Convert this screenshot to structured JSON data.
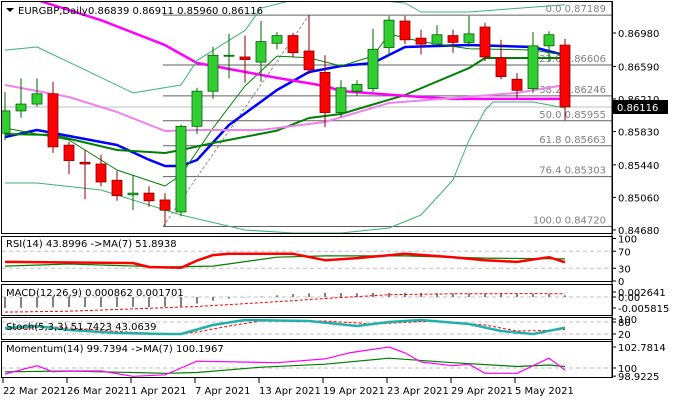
{
  "header": {
    "symbol": "EURGBP,Daily",
    "ohlc": "0.86839 0.86911 0.85960 0.86116"
  },
  "colors": {
    "bull": "#32cd32",
    "bear": "#ff0000",
    "bull_border": "#006400",
    "bear_border": "#8b0000",
    "ema_blue": "#0000ff",
    "ma_green": "#008000",
    "ma_magenta": "#ff00ff",
    "ma_violet": "#ee82ee",
    "bollinger": "#3cb371",
    "macd_hist": "#808080",
    "stoch_k": "#20b2aa"
  },
  "chart_data": {
    "type": "candlestick",
    "title": "EURGBP,Daily",
    "ylim": [
      0.8462,
      0.8738
    ],
    "price_axis_ticks": [
      "0.86980",
      "0.86590",
      "0.86210",
      "0.85830",
      "0.85440",
      "0.85060",
      "0.84680"
    ],
    "price_axis_values": [
      0.8698,
      0.8659,
      0.8621,
      0.8583,
      0.8544,
      0.8506,
      0.8468
    ],
    "current_price": "0.86116",
    "date_ticks": [
      {
        "i": 0,
        "label": "22 Mar 2021"
      },
      {
        "i": 4,
        "label": "26 Mar 2021"
      },
      {
        "i": 8,
        "label": "1 Apr 2021"
      },
      {
        "i": 12,
        "label": "7 Apr 2021"
      },
      {
        "i": 16,
        "label": "13 Apr 2021"
      },
      {
        "i": 20,
        "label": "19 Apr 2021"
      },
      {
        "i": 24,
        "label": "23 Apr 2021"
      },
      {
        "i": 28,
        "label": "29 Apr 2021"
      },
      {
        "i": 32,
        "label": "5 May 2021"
      }
    ],
    "candles": [
      [
        0.8581,
        0.8629,
        0.8573,
        0.8607
      ],
      [
        0.8607,
        0.8645,
        0.8599,
        0.8615
      ],
      [
        0.8615,
        0.8645,
        0.8612,
        0.8627
      ],
      [
        0.8627,
        0.8641,
        0.8558,
        0.8565
      ],
      [
        0.8567,
        0.8571,
        0.8533,
        0.8549
      ],
      [
        0.8547,
        0.8561,
        0.8504,
        0.8545
      ],
      [
        0.8545,
        0.8556,
        0.8519,
        0.8524
      ],
      [
        0.8526,
        0.8537,
        0.8502,
        0.8508
      ],
      [
        0.8509,
        0.8532,
        0.8491,
        0.8511
      ],
      [
        0.8511,
        0.8519,
        0.8495,
        0.8502
      ],
      [
        0.8503,
        0.8511,
        0.8472,
        0.8491
      ],
      [
        0.8489,
        0.8591,
        0.8484,
        0.8589
      ],
      [
        0.8589,
        0.8634,
        0.858,
        0.863
      ],
      [
        0.863,
        0.8682,
        0.8621,
        0.8672
      ],
      [
        0.8671,
        0.8697,
        0.8645,
        0.8672
      ],
      [
        0.867,
        0.8695,
        0.864,
        0.8667
      ],
      [
        0.8664,
        0.8712,
        0.8641,
        0.8688
      ],
      [
        0.8686,
        0.8699,
        0.8679,
        0.8695
      ],
      [
        0.8695,
        0.8698,
        0.867,
        0.8675
      ],
      [
        0.8677,
        0.87189,
        0.865,
        0.8655
      ],
      [
        0.8652,
        0.8672,
        0.8588,
        0.8605
      ],
      [
        0.8605,
        0.8643,
        0.86,
        0.8634
      ],
      [
        0.863,
        0.8643,
        0.8625,
        0.8638
      ],
      [
        0.8633,
        0.8703,
        0.8629,
        0.8679
      ],
      [
        0.8681,
        0.8718,
        0.8671,
        0.8713
      ],
      [
        0.8712,
        0.8718,
        0.8685,
        0.869
      ],
      [
        0.8692,
        0.8702,
        0.8673,
        0.8685
      ],
      [
        0.8685,
        0.8707,
        0.8684,
        0.8696
      ],
      [
        0.8695,
        0.8702,
        0.8675,
        0.8687
      ],
      [
        0.8687,
        0.8718,
        0.8682,
        0.8697
      ],
      [
        0.8705,
        0.871,
        0.8665,
        0.867
      ],
      [
        0.8669,
        0.869,
        0.8644,
        0.8647
      ],
      [
        0.8644,
        0.8651,
        0.8622,
        0.8631
      ],
      [
        0.8633,
        0.8699,
        0.8628,
        0.8683
      ],
      [
        0.8683,
        0.87,
        0.8665,
        0.8696
      ],
      [
        0.86839,
        0.86911,
        0.8596,
        0.86116
      ]
    ],
    "overlays": [
      {
        "name": "ema-blue",
        "color": "#0000ff",
        "width": 2.5,
        "points": [
          [
            0,
            0.85765
          ],
          [
            2,
            0.85847
          ],
          [
            7,
            0.85672
          ],
          [
            9,
            0.855
          ],
          [
            10,
            0.85427
          ],
          [
            11,
            0.85427
          ],
          [
            12,
            0.85497
          ],
          [
            14,
            0.85905
          ],
          [
            17,
            0.86314
          ],
          [
            19,
            0.86524
          ],
          [
            21,
            0.86595
          ],
          [
            23,
            0.8663
          ],
          [
            25,
            0.86816
          ],
          [
            29,
            0.8684
          ],
          [
            33,
            0.86816
          ],
          [
            35,
            0.8672
          ]
        ]
      },
      {
        "name": "ma-green-slow",
        "color": "#008000",
        "width": 2,
        "points": [
          [
            0,
            0.858
          ],
          [
            3,
            0.85789
          ],
          [
            7,
            0.85613
          ],
          [
            10,
            0.85578
          ],
          [
            11,
            0.85613
          ],
          [
            13,
            0.85695
          ],
          [
            17,
            0.8584
          ],
          [
            19,
            0.85987
          ],
          [
            21,
            0.86034
          ],
          [
            25,
            0.86256
          ],
          [
            29,
            0.8657
          ],
          [
            30,
            0.86688
          ],
          [
            35,
            0.86688
          ]
        ]
      },
      {
        "name": "ma-green-fast",
        "color": "#008000",
        "width": 1,
        "points": [
          [
            0,
            0.8587
          ],
          [
            4,
            0.8573
          ],
          [
            7,
            0.8538
          ],
          [
            10,
            0.85193
          ],
          [
            11,
            0.85321
          ],
          [
            13,
            0.8587
          ],
          [
            15,
            0.86361
          ],
          [
            17,
            0.8671
          ],
          [
            19,
            0.8669
          ],
          [
            21,
            0.86595
          ],
          [
            23,
            0.8671
          ],
          [
            24,
            0.86968
          ],
          [
            26,
            0.8688
          ],
          [
            29,
            0.86795
          ],
          [
            33,
            0.86781
          ],
          [
            35,
            0.8672
          ]
        ]
      },
      {
        "name": "ma-magenta",
        "color": "#ff00ff",
        "width": 2.5,
        "points": [
          [
            2,
            0.87365
          ],
          [
            6,
            0.8713
          ],
          [
            10,
            0.86839
          ],
          [
            12,
            0.8663
          ],
          [
            17,
            0.86455
          ],
          [
            20,
            0.86361
          ],
          [
            21,
            0.86303
          ],
          [
            26,
            0.86233
          ],
          [
            28,
            0.8621
          ],
          [
            35,
            0.8621
          ]
        ]
      },
      {
        "name": "ma-violet",
        "color": "#ee82ee",
        "width": 2,
        "points": [
          [
            0,
            0.86373
          ],
          [
            4,
            0.86233
          ],
          [
            7,
            0.86057
          ],
          [
            10,
            0.85835
          ],
          [
            12,
            0.85847
          ],
          [
            16,
            0.85847
          ],
          [
            20,
            0.8594
          ],
          [
            24,
            0.86162
          ],
          [
            28,
            0.86221
          ],
          [
            32,
            0.8628
          ],
          [
            35,
            0.86373
          ]
        ]
      },
      {
        "name": "bollinger-upper",
        "color": "#3cb371",
        "width": 1,
        "points": [
          [
            0,
            0.8678
          ],
          [
            2,
            0.86816
          ],
          [
            5,
            0.8655
          ],
          [
            8,
            0.8628
          ],
          [
            11,
            0.86373
          ],
          [
            12,
            0.8666
          ],
          [
            15,
            0.8701
          ],
          [
            16,
            0.8727
          ],
          [
            18,
            0.87365
          ],
          [
            23,
            0.87365
          ],
          [
            25,
            0.8733
          ],
          [
            26,
            0.87225
          ],
          [
            29,
            0.87225
          ],
          [
            35,
            0.8731
          ]
        ]
      },
      {
        "name": "bollinger-lower",
        "color": "#3cb371",
        "width": 1,
        "points": [
          [
            0,
            0.85228
          ],
          [
            2,
            0.85228
          ],
          [
            6,
            0.85146
          ],
          [
            9,
            0.84971
          ],
          [
            11,
            0.84854
          ],
          [
            15,
            0.84679
          ],
          [
            18,
            0.84644
          ],
          [
            21,
            0.84644
          ],
          [
            24,
            0.84702
          ],
          [
            26,
            0.84854
          ],
          [
            28,
            0.85263
          ],
          [
            29,
            0.8573
          ],
          [
            30,
            0.8608
          ],
          [
            30.5,
            0.86174
          ],
          [
            33,
            0.86174
          ],
          [
            35,
            0.86104
          ]
        ]
      }
    ],
    "fibonacci": {
      "levels": [
        {
          "label": "0.0 0.87189",
          "price": 0.87189
        },
        {
          "label": "23.6 0.86606",
          "price": 0.86606
        },
        {
          "label": "38.2 0.86246",
          "price": 0.86246
        },
        {
          "label": "50.0 0.85955",
          "price": 0.85955
        },
        {
          "label": "61.8 0.85663",
          "price": 0.85663
        },
        {
          "label": "76.4 0.85303",
          "price": 0.85303
        },
        {
          "label": "100.0 0.84720",
          "price": 0.8472
        }
      ],
      "anchor_low_index": 10,
      "anchor_high_index": 19
    },
    "rsi": {
      "label": "RSI(14) 43.8996  ->MA(7) 51.8938",
      "axis": [
        "100",
        "70",
        "30",
        "0"
      ],
      "axis_values": [
        100,
        70,
        30,
        0
      ],
      "levels": [
        70,
        30
      ],
      "rsi": [
        [
          0,
          45
        ],
        [
          8,
          42
        ],
        [
          9,
          33
        ],
        [
          11,
          31
        ],
        [
          12,
          48
        ],
        [
          13,
          61
        ],
        [
          14,
          64
        ],
        [
          18,
          64
        ],
        [
          20,
          49
        ],
        [
          22,
          54
        ],
        [
          25,
          64
        ],
        [
          28,
          56
        ],
        [
          30,
          49
        ],
        [
          32,
          45
        ],
        [
          34,
          56
        ],
        [
          35,
          43.9
        ]
      ],
      "ma": [
        [
          0,
          35
        ],
        [
          4,
          40
        ],
        [
          10,
          33
        ],
        [
          13,
          35
        ],
        [
          17,
          56
        ],
        [
          20,
          59
        ],
        [
          25,
          59
        ],
        [
          30,
          54
        ],
        [
          35,
          51.9
        ]
      ]
    },
    "macd": {
      "label": "MACD(12,26,9) 0.000862 0.001701",
      "axis": [
        "0.002641",
        "0.00",
        "-0.005815"
      ],
      "axis_values": [
        0.002641,
        0,
        -0.005815
      ],
      "hist": [
        -0.0058,
        -0.0057,
        -0.0056,
        -0.0055,
        -0.0054,
        -0.0053,
        -0.0053,
        -0.0053,
        -0.0052,
        -0.0053,
        -0.0051,
        -0.005,
        -0.0035,
        -0.002,
        -0.0008,
        -0.0002,
        0.0003,
        0.0009,
        0.0015,
        0.0019,
        0.0022,
        0.0021,
        0.002,
        0.0021,
        0.0022,
        0.0022,
        0.0021,
        0.002,
        0.0019,
        0.0019,
        0.0018,
        0.0017,
        0.0016,
        0.0016,
        0.0016,
        0.000862
      ],
      "signal": [
        [
          0,
          -0.008
        ],
        [
          4,
          -0.0075
        ],
        [
          8,
          -0.0063
        ],
        [
          12,
          -0.005
        ],
        [
          16,
          -0.003
        ],
        [
          20,
          -0.0008
        ],
        [
          24,
          0.0012
        ],
        [
          28,
          0.0017
        ],
        [
          33,
          0.0018
        ],
        [
          35,
          0.001701
        ]
      ]
    },
    "stochastic": {
      "label": "Stoch(5,3,3) 51.7423 43.0639",
      "axis": [
        "100",
        "80",
        "20"
      ],
      "axis_values": [
        100,
        80,
        20
      ],
      "levels": [
        80,
        20
      ],
      "k": [
        [
          0,
          50
        ],
        [
          2,
          60
        ],
        [
          4,
          40
        ],
        [
          7,
          25
        ],
        [
          10,
          20
        ],
        [
          11,
          20
        ],
        [
          13,
          65
        ],
        [
          15,
          90
        ],
        [
          19,
          85
        ],
        [
          22,
          60
        ],
        [
          24,
          80
        ],
        [
          26,
          90
        ],
        [
          29,
          70
        ],
        [
          31,
          35
        ],
        [
          33,
          20
        ],
        [
          35,
          51.74
        ]
      ],
      "d": [
        [
          0,
          45
        ],
        [
          3,
          55
        ],
        [
          5,
          45
        ],
        [
          8,
          28
        ],
        [
          11,
          20
        ],
        [
          12,
          30
        ],
        [
          14,
          60
        ],
        [
          16,
          85
        ],
        [
          20,
          85
        ],
        [
          23,
          70
        ],
        [
          25,
          78
        ],
        [
          27,
          85
        ],
        [
          30,
          65
        ],
        [
          32,
          35
        ],
        [
          34,
          38
        ],
        [
          35,
          43.06
        ]
      ]
    },
    "momentum": {
      "label": "Momentum(14) 99.7394  ->MA(7) 100.1967",
      "axis": [
        "102.7814",
        "100",
        "98.9225"
      ],
      "axis_values": [
        102.7814,
        100,
        98.9225
      ],
      "levels": [
        100
      ],
      "momentum": [
        [
          0,
          99.2
        ],
        [
          2,
          100.3
        ],
        [
          3,
          99.5
        ],
        [
          4,
          99.6
        ],
        [
          6,
          99.6
        ],
        [
          8,
          98.9
        ],
        [
          10,
          99.1
        ],
        [
          11,
          100
        ],
        [
          12,
          100.9
        ],
        [
          17,
          100.7
        ],
        [
          20,
          101.2
        ],
        [
          21.5,
          102
        ],
        [
          24,
          102.78
        ],
        [
          25,
          102
        ],
        [
          26,
          100.8
        ],
        [
          28,
          100.3
        ],
        [
          29,
          100.5
        ],
        [
          30,
          99.3
        ],
        [
          32,
          99.3
        ],
        [
          34,
          101.3
        ],
        [
          35,
          99.74
        ]
      ],
      "ma": [
        [
          0,
          99.5
        ],
        [
          4,
          99.6
        ],
        [
          10,
          99.3
        ],
        [
          12,
          99.4
        ],
        [
          16,
          100.1
        ],
        [
          20,
          100.5
        ],
        [
          24,
          101.3
        ],
        [
          28,
          100.7
        ],
        [
          32,
          100.2
        ],
        [
          34,
          100.4
        ],
        [
          35,
          100.2
        ]
      ]
    }
  }
}
